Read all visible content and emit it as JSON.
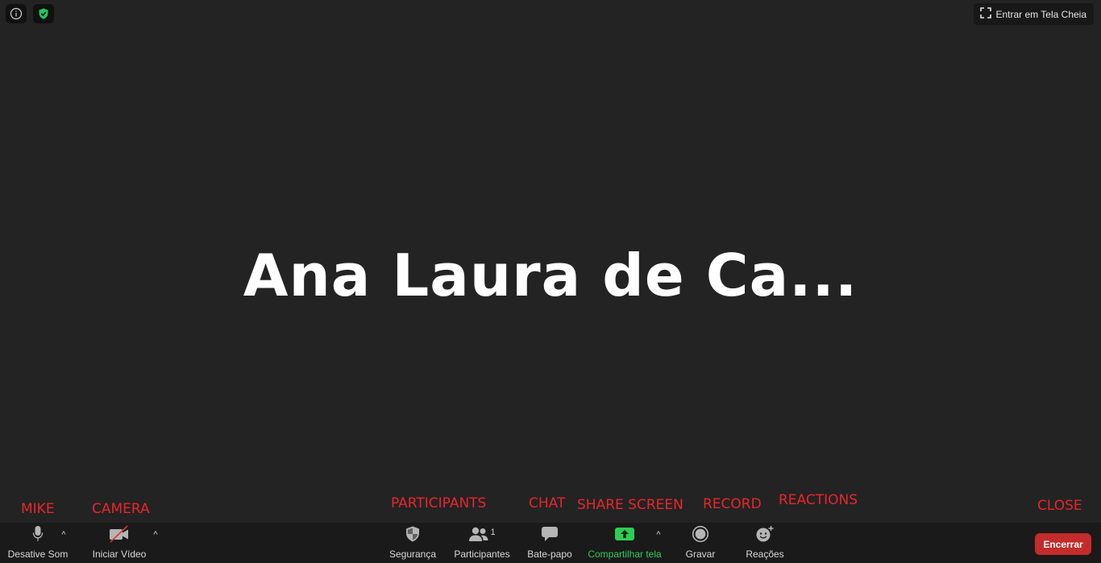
{
  "meeting": {
    "participant_name": "Ana Laura de Ca...",
    "fullscreen_label": "Entrar em Tela Cheia"
  },
  "annotations": {
    "mike": "MIKE",
    "camera": "CAMERA",
    "participants": "PARTICIPANTS",
    "chat": "CHAT",
    "share_screen": "SHARE SCREEN",
    "record": "RECORD",
    "reactions": "REACTIONS",
    "close": "CLOSE"
  },
  "toolbar": {
    "mute_label": "Desative Som",
    "video_label": "Iniciar Vídeo",
    "security_label": "Segurança",
    "participants_label": "Participantes",
    "participants_count": "1",
    "chat_label": "Bate-papo",
    "share_label": "Compartilhar tela",
    "record_label": "Gravar",
    "reactions_label": "Reações",
    "end_label": "Encerrar"
  },
  "colors": {
    "background": "#232323",
    "toolbar": "#1a1a1a",
    "annotation": "#e8262b",
    "share_green": "#2ecc55",
    "end_red": "#c42b2b",
    "shield_green": "#22c55e"
  }
}
